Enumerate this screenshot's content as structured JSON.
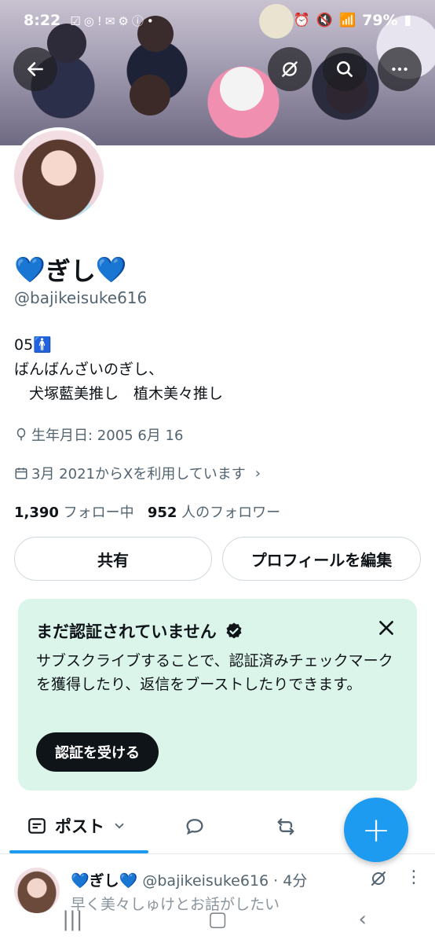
{
  "status_bar": {
    "time": "8:22",
    "battery": "79%"
  },
  "header": {
    "icons": [
      "back-arrow-icon",
      "grok-icon",
      "search-icon",
      "more-icon"
    ]
  },
  "profile": {
    "display_name": "ぎし",
    "name_emoji": "💙",
    "handle": "@bajikeisuke616",
    "bio": "05🚹\nばんばんざいのぎし、\n　犬塚藍美推し　植木美々推し",
    "birthday": "生年月日: 2005 6月 16",
    "joined": "3月 2021からXを利用しています",
    "following_count": "1,390",
    "following_label": "フォロー中",
    "followers_count": "952",
    "followers_label": "人のフォロワー"
  },
  "actions": {
    "share_label": "共有",
    "edit_label": "プロフィールを編集"
  },
  "verify_card": {
    "title": "まだ認証されていません",
    "body": "サブスクライブすることで、認証済みチェックマークを獲得したり、返信をブーストしたりできます。",
    "button": "認証を受ける",
    "accent": "#dcf5ea"
  },
  "tabs": {
    "active_label": "ポスト"
  },
  "tweet": {
    "name": "ぎし",
    "handle_time": "@bajikeisuke616 · 4分",
    "text": "早く美々しゅけとお話がしたい"
  },
  "colors": {
    "accent": "#1d9bf0",
    "text": "#0f1419",
    "muted": "#536471"
  }
}
